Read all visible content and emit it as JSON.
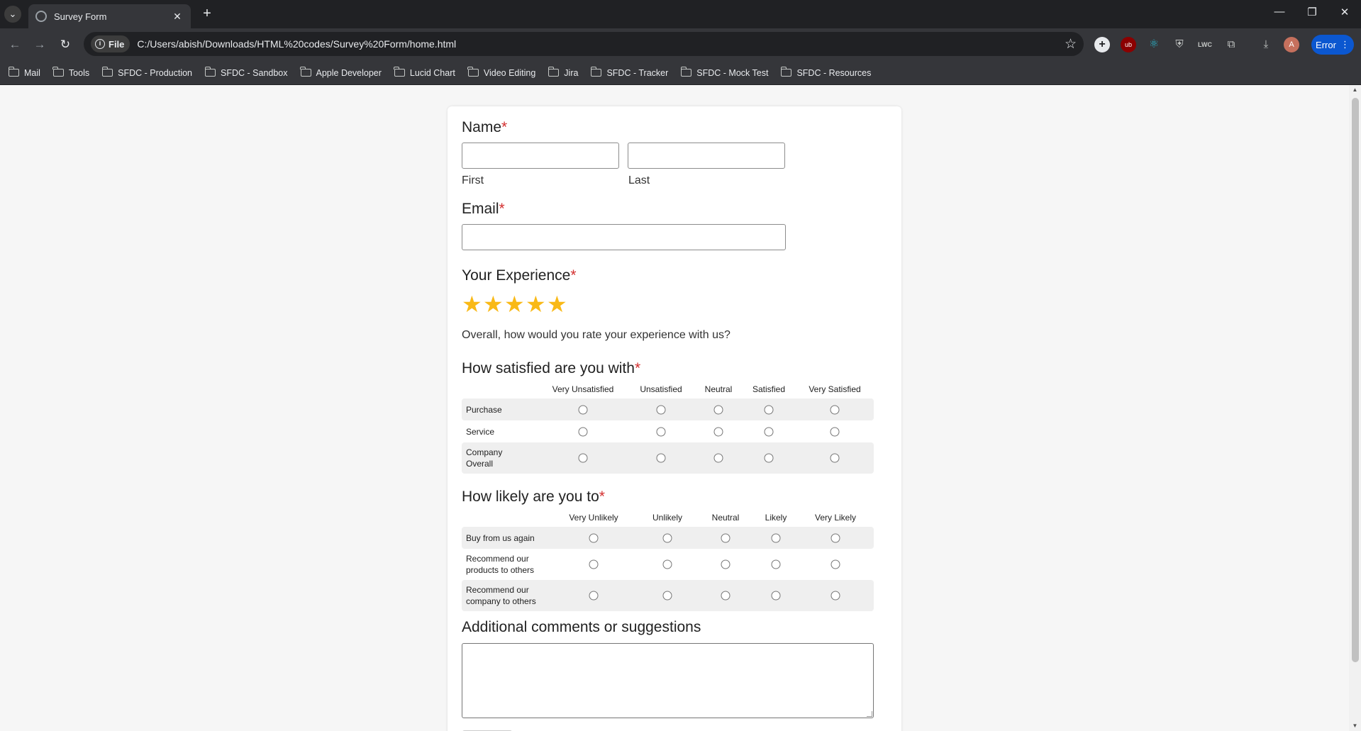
{
  "browser": {
    "tab_title": "Survey Form",
    "scheme_chip": "File",
    "url": "C:/Users/abish/Downloads/HTML%20codes/Survey%20Form/home.html",
    "profile_status": "Error",
    "bookmarks": [
      "Mail",
      "Tools",
      "SFDC - Production",
      "SFDC - Sandbox",
      "Apple Developer",
      "Lucid Chart",
      "Video Editing",
      "Jira",
      "SFDC - Tracker",
      "SFDC - Mock Test",
      "SFDC - Resources"
    ]
  },
  "form": {
    "name": {
      "title": "Name",
      "required": "*",
      "first_label": "First",
      "last_label": "Last",
      "first_value": "",
      "last_value": ""
    },
    "email": {
      "title": "Email",
      "required": "*",
      "value": ""
    },
    "experience": {
      "title": "Your Experience",
      "required": "*",
      "stars_filled": 5,
      "stars_total": 5,
      "prompt": "Overall, how would you rate your experience with us?"
    },
    "satisfaction": {
      "title": "How satisfied are you with",
      "required": "*",
      "columns": [
        "Very Unsatisfied",
        "Unsatisfied",
        "Neutral",
        "Satisfied",
        "Very Satisfied"
      ],
      "rows": [
        [
          "Purchase"
        ],
        [
          "Service"
        ],
        [
          "Company",
          "Overall"
        ]
      ]
    },
    "likelihood": {
      "title": "How likely are you to",
      "required": "*",
      "columns": [
        "Very Unlikely",
        "Unlikely",
        "Neutral",
        "Likely",
        "Very Likely"
      ],
      "rows": [
        [
          "Buy from us again"
        ],
        [
          "Recommend our",
          "products to others"
        ],
        [
          "Recommend our",
          "company to others"
        ]
      ]
    },
    "comments": {
      "title": "Additional comments or suggestions",
      "value": ""
    }
  },
  "colors": {
    "required": "#d32f2f",
    "star": "#f9b916",
    "error_pill": "#0b57d0"
  }
}
